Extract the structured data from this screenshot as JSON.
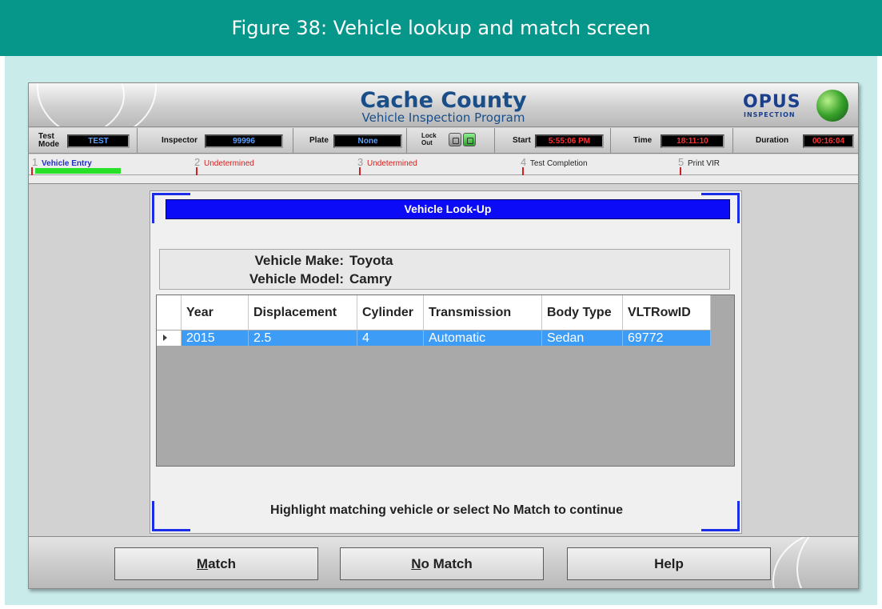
{
  "caption": "Figure 38: Vehicle lookup and match screen",
  "app": {
    "title": "Cache County",
    "subtitle": "Vehicle Inspection Program",
    "logo": {
      "name": "OPUS",
      "sub": "INSPECTION"
    }
  },
  "status": {
    "test_mode_label": "Test Mode",
    "test_mode_value": "TEST",
    "inspector_label": "Inspector",
    "inspector_value": "99996",
    "plate_label": "Plate",
    "plate_value": "None",
    "lockout_label": "Lock Out",
    "start_label": "Start",
    "start_value": "5:55:06 PM",
    "time_label": "Time",
    "time_value": "18:11:10",
    "duration_label": "Duration",
    "duration_value": "00:16:04"
  },
  "steps": [
    {
      "num": "1",
      "label": "Vehicle Entry",
      "state": "active"
    },
    {
      "num": "2",
      "label": "Undetermined",
      "state": "undetermined"
    },
    {
      "num": "3",
      "label": "Undetermined",
      "state": "undetermined"
    },
    {
      "num": "4",
      "label": "Test Completion",
      "state": "pending"
    },
    {
      "num": "5",
      "label": "Print VIR",
      "state": "pending"
    }
  ],
  "lookup": {
    "title": "Vehicle Look-Up",
    "make_label": "Vehicle Make:",
    "make_value": "Toyota",
    "model_label": "Vehicle Model:",
    "model_value": "Camry",
    "columns": [
      "Year",
      "Displacement",
      "Cylinder",
      "Transmission",
      "Body Type",
      "VLTRowID"
    ],
    "rows": [
      [
        "2015",
        "2.5",
        "4",
        "Automatic",
        "Sedan",
        "69772"
      ]
    ],
    "instruction": "Highlight matching vehicle or select No Match to continue"
  },
  "buttons": {
    "match_mnemonic": "M",
    "match_rest": "atch",
    "nomatch_mnemonic": "N",
    "nomatch_rest": "o Match",
    "help": "Help"
  },
  "colors": {
    "caption_bg": "#07968a",
    "caption_body": "#c9ebea",
    "title_blue": "#0b0bf8",
    "selected_row": "#3d9cf5",
    "progress_green": "#28e028"
  }
}
